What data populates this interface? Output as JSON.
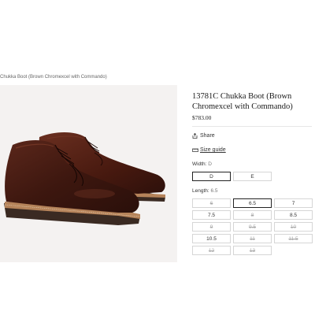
{
  "breadcrumb": "Chukka Boot (Brown Chromexcel with Commando)",
  "product": {
    "title": "13781C Chukka Boot (Brown Chromexcel with Commando)",
    "price": "$783.00"
  },
  "actions": {
    "share_label": "Share",
    "share_icon": "share-icon",
    "size_guide_label": "Size guide",
    "size_guide_icon": "ruler-icon"
  },
  "width": {
    "label": "Width:",
    "selected": "D",
    "options": [
      {
        "label": "D",
        "selected": true,
        "available": true
      },
      {
        "label": "E",
        "selected": false,
        "available": true
      }
    ]
  },
  "length": {
    "label": "Length:",
    "selected": "6.5",
    "options": [
      {
        "label": "6",
        "selected": false,
        "available": false
      },
      {
        "label": "6.5",
        "selected": true,
        "available": true
      },
      {
        "label": "7",
        "selected": false,
        "available": true
      },
      {
        "label": "7.5",
        "selected": false,
        "available": true
      },
      {
        "label": "8",
        "selected": false,
        "available": false
      },
      {
        "label": "8.5",
        "selected": false,
        "available": true
      },
      {
        "label": "9",
        "selected": false,
        "available": false
      },
      {
        "label": "9.5",
        "selected": false,
        "available": false
      },
      {
        "label": "10",
        "selected": false,
        "available": false
      },
      {
        "label": "10.5",
        "selected": false,
        "available": true
      },
      {
        "label": "11",
        "selected": false,
        "available": false
      },
      {
        "label": "11.5",
        "selected": false,
        "available": false
      },
      {
        "label": "12",
        "selected": false,
        "available": false
      },
      {
        "label": "13",
        "selected": false,
        "available": false
      }
    ]
  },
  "colors": {
    "leather": "#4a1f16",
    "welt": "#b5835a",
    "sole": "#3a2a22"
  }
}
